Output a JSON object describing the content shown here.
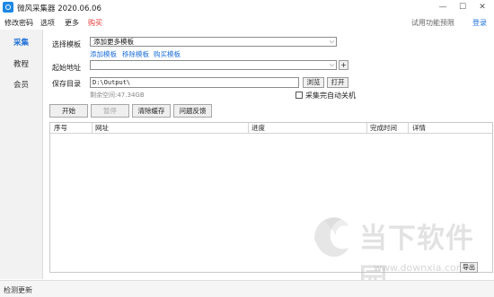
{
  "window": {
    "title": "微风采集器 2020.06.06",
    "minimize": "—",
    "maximize": "☐",
    "close": "✕"
  },
  "menu": {
    "items": [
      "修改密码",
      "选项",
      "更多",
      "购买"
    ],
    "trial": "试用功能预限",
    "login": "登录"
  },
  "sidebar": {
    "items": [
      "采集",
      "教程",
      "会员"
    ]
  },
  "form": {
    "template_label": "选择模板",
    "template_value": "添加更多模板",
    "template_links": [
      "添加模板",
      "移除模板",
      "购买模板"
    ],
    "start_url_label": "起始地址",
    "start_url_value": "",
    "add_button": "+",
    "save_dir_label": "保存目录",
    "save_dir_value": "D:\\Output\\",
    "browse_button": "浏览",
    "open_button": "打开",
    "free_space": "剩余空间:47.34GB",
    "shutdown_checkbox": "采集完自动关机"
  },
  "actions": [
    "开始",
    "暂停",
    "清除缓存",
    "问题反馈"
  ],
  "table": {
    "columns": [
      "序号",
      "网址",
      "进度",
      "完成时间",
      "详情"
    ]
  },
  "watermark": {
    "text": "当下软件园",
    "url": "www.downxia.com"
  },
  "export_button": "导出",
  "status": {
    "text": "检测更新"
  },
  "colors": {
    "accent": "#1e70d8",
    "red": "#e53935"
  }
}
